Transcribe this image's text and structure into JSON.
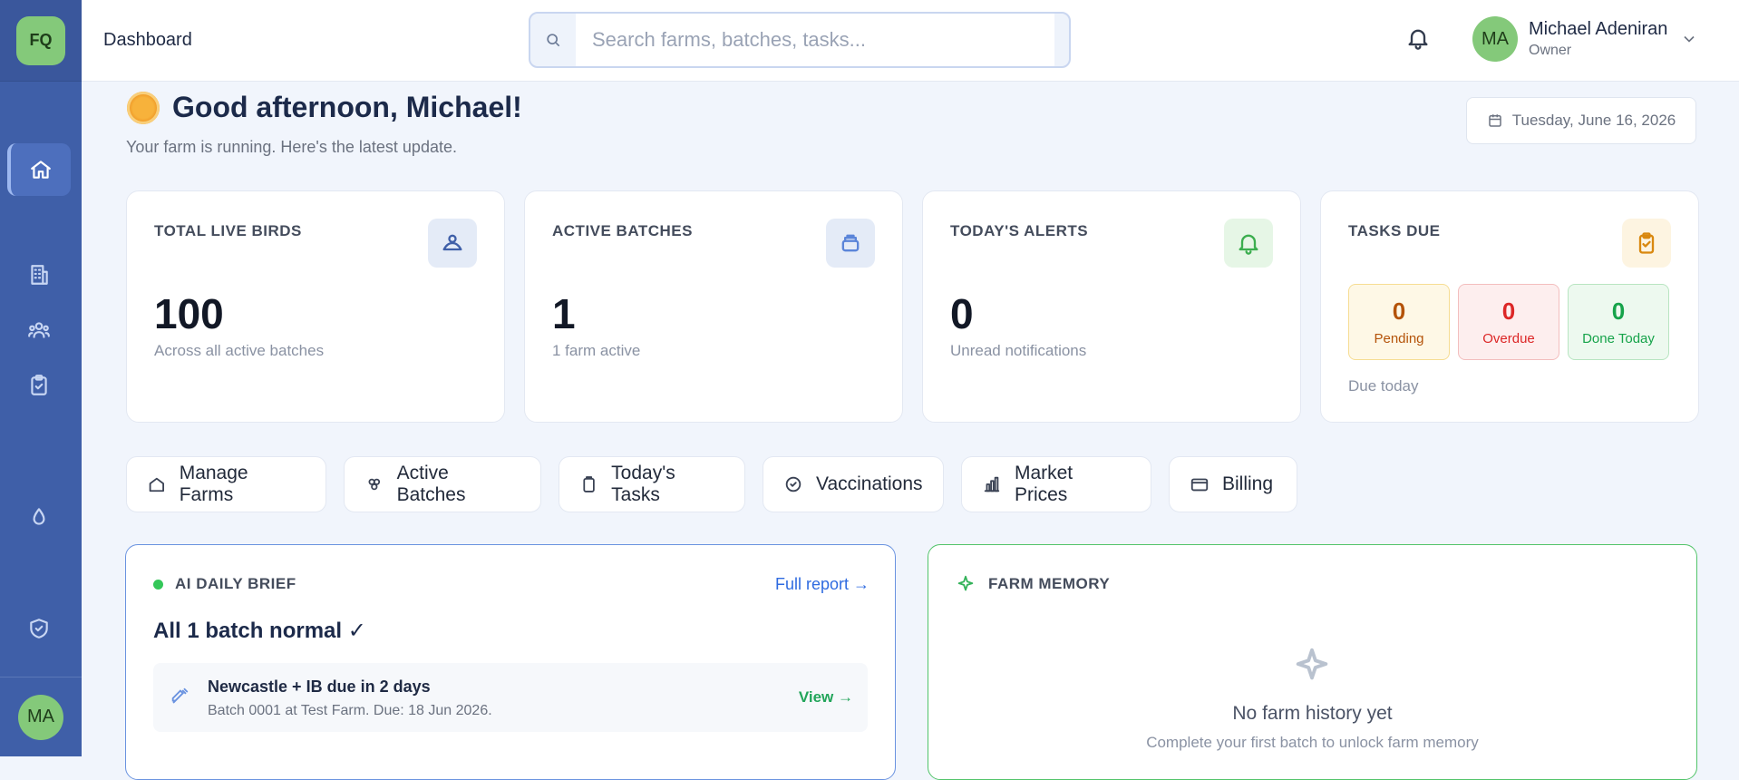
{
  "sidebar": {
    "logo": "FQ",
    "user_initials": "MA",
    "items": [
      {
        "name": "home",
        "icon": "home-icon"
      },
      {
        "name": "farms",
        "icon": "building-icon"
      },
      {
        "name": "team",
        "icon": "users-icon"
      },
      {
        "name": "tasks",
        "icon": "clipboard-icon"
      },
      {
        "name": "timer",
        "icon": "timer-icon"
      },
      {
        "name": "health",
        "icon": "shield-check-icon"
      }
    ]
  },
  "header": {
    "title": "Dashboard",
    "search_placeholder": "Search farms, batches, tasks...",
    "user": {
      "initials": "MA",
      "name": "Michael Adeniran",
      "role": "Owner"
    }
  },
  "greeting": {
    "title": "Good afternoon, Michael!",
    "subtitle": "Your farm is running. Here's the latest update.",
    "date": "Tuesday, June 16, 2026"
  },
  "stats": {
    "birds": {
      "label": "TOTAL LIVE BIRDS",
      "value": "100",
      "sub": "Across all active batches"
    },
    "batches": {
      "label": "ACTIVE BATCHES",
      "value": "1",
      "sub": "1 farm active"
    },
    "alerts": {
      "label": "TODAY'S ALERTS",
      "value": "0",
      "sub": "Unread notifications"
    },
    "tasks": {
      "label": "TASKS DUE",
      "pending": {
        "value": "0",
        "label": "Pending"
      },
      "overdue": {
        "value": "0",
        "label": "Overdue"
      },
      "done": {
        "value": "0",
        "label": "Done Today"
      },
      "sub": "Due today"
    }
  },
  "quick_actions": [
    {
      "label": "Manage Farms"
    },
    {
      "label": "Active Batches"
    },
    {
      "label": "Today's Tasks"
    },
    {
      "label": "Vaccinations"
    },
    {
      "label": "Market Prices"
    },
    {
      "label": "Billing"
    }
  ],
  "ai_brief": {
    "label": "AI DAILY BRIEF",
    "link": "Full report →",
    "title": "All 1 batch normal ✓",
    "alert": {
      "title": "Newcastle + IB due in 2 days",
      "sub": "Batch 0001 at Test Farm. Due: 18 Jun 2026.",
      "action": "View →"
    }
  },
  "farm_memory": {
    "label": "FARM MEMORY",
    "empty_title": "No farm history yet",
    "empty_sub": "Complete your first batch to unlock farm memory"
  },
  "colors": {
    "sidebar": "#3f5fa8",
    "accent_green": "#84c97a",
    "link_blue": "#2f6be0",
    "pending": "#b45309",
    "overdue": "#dc2626",
    "done": "#16a34a"
  }
}
